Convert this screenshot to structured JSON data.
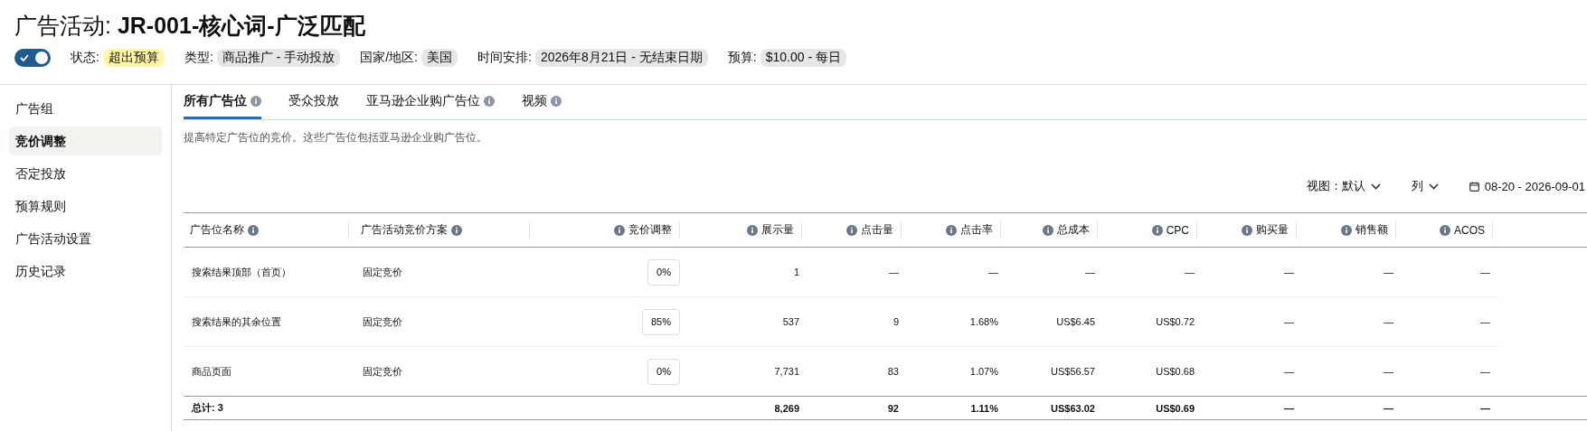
{
  "title": {
    "label": "广告活动:",
    "name": "JR-001-核心词-广泛匹配"
  },
  "toggle": {
    "on": true
  },
  "meta": [
    {
      "label": "状态:",
      "value": "超出预算",
      "kind": "warning"
    },
    {
      "label": "类型:",
      "value": "商品推广 - 手动投放",
      "kind": "tag"
    },
    {
      "label": "国家/地区:",
      "value": "美国",
      "kind": "tag"
    },
    {
      "label": "时间安排:",
      "value": "2026年8月21日 - 无结束日期",
      "kind": "tag"
    },
    {
      "label": "预算:",
      "value": "$10.00 - 每日",
      "kind": "tag"
    }
  ],
  "sidebar": {
    "items": [
      {
        "label": "广告组",
        "selected": false
      },
      {
        "label": "竞价调整",
        "selected": true
      },
      {
        "label": "否定投放",
        "selected": false
      },
      {
        "label": "预算规则",
        "selected": false
      },
      {
        "label": "广告活动设置",
        "selected": false
      },
      {
        "label": "历史记录",
        "selected": false
      }
    ]
  },
  "tabs": [
    {
      "label": "所有广告位",
      "selected": true,
      "info": true
    },
    {
      "label": "受众投放",
      "selected": false,
      "info": false
    },
    {
      "label": "亚马逊企业购广告位",
      "selected": false,
      "info": true
    },
    {
      "label": "视频",
      "selected": false,
      "info": true
    }
  ],
  "description": "提高特定广告位的竞价。这些广告位包括亚马逊企业购广告位。",
  "toolbar": {
    "view_label": "视图：",
    "view_value": "默认",
    "columns_label": "列",
    "date_range": "08-20 - 2026-09-01"
  },
  "table": {
    "columns": [
      {
        "label": "广告位名称",
        "kind": "text"
      },
      {
        "label": "广告活动竞价方案",
        "kind": "text"
      },
      {
        "label": "竞价调整",
        "kind": "input"
      },
      {
        "label": "展示量",
        "kind": "number"
      },
      {
        "label": "点击量",
        "kind": "number"
      },
      {
        "label": "点击率",
        "kind": "number"
      },
      {
        "label": "总成本",
        "kind": "number"
      },
      {
        "label": "CPC",
        "kind": "number"
      },
      {
        "label": "购买量",
        "kind": "number"
      },
      {
        "label": "销售额",
        "kind": "number"
      },
      {
        "label": "ACOS",
        "kind": "number"
      }
    ],
    "rows": [
      {
        "cells": [
          "搜索结果顶部（首页）",
          "固定竞价",
          "0%",
          "1",
          "—",
          "—",
          "—",
          "—",
          "—",
          "—",
          "—"
        ]
      },
      {
        "cells": [
          "搜索结果的其余位置",
          "固定竞价",
          "85%",
          "537",
          "9",
          "1.68%",
          "US$6.45",
          "US$0.72",
          "—",
          "—",
          "—"
        ]
      },
      {
        "cells": [
          "商品页面",
          "固定竞价",
          "0%",
          "7,731",
          "83",
          "1.07%",
          "US$56.57",
          "US$0.68",
          "—",
          "—",
          "—"
        ]
      }
    ],
    "total": {
      "label": "总计: 3",
      "values": [
        "8,269",
        "92",
        "1.11%",
        "US$63.02",
        "US$0.69",
        "—",
        "—",
        "—"
      ]
    }
  }
}
